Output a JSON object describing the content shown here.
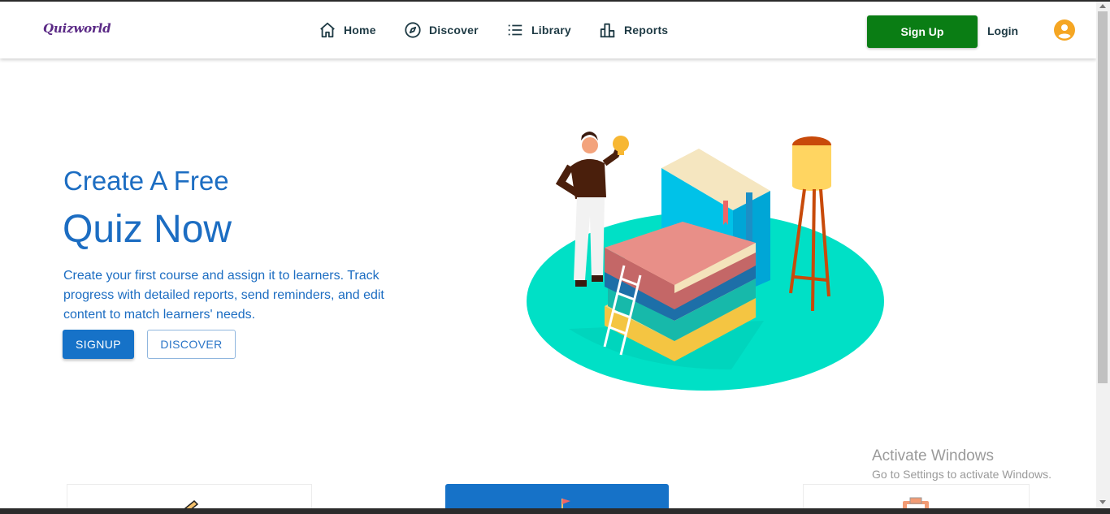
{
  "brand": {
    "logo_text": "Quizworld"
  },
  "nav": {
    "items": [
      {
        "label": "Home",
        "icon": "home-icon"
      },
      {
        "label": "Discover",
        "icon": "compass-icon"
      },
      {
        "label": "Library",
        "icon": "list-icon"
      },
      {
        "label": "Reports",
        "icon": "bar-chart-icon"
      }
    ],
    "signup_label": "Sign Up",
    "login_label": "Login",
    "user_icon": "user-circle-icon"
  },
  "hero": {
    "subtitle": "Create A Free",
    "title": "Quiz Now",
    "description": "Create your first course and assign it to learners. Track progress with detailed reports, send reminders, and edit content to match learners' needs.",
    "primary_button": "SIGNUP",
    "secondary_button": "DISCOVER"
  },
  "watermark": {
    "line1": "Activate Windows",
    "line2": "Go to Settings to activate Windows."
  },
  "colors": {
    "brand_blue": "#1c6dc2",
    "signup_green": "#0a7d14",
    "nav_text": "#1e3a44",
    "teal": "#00e0c6"
  }
}
